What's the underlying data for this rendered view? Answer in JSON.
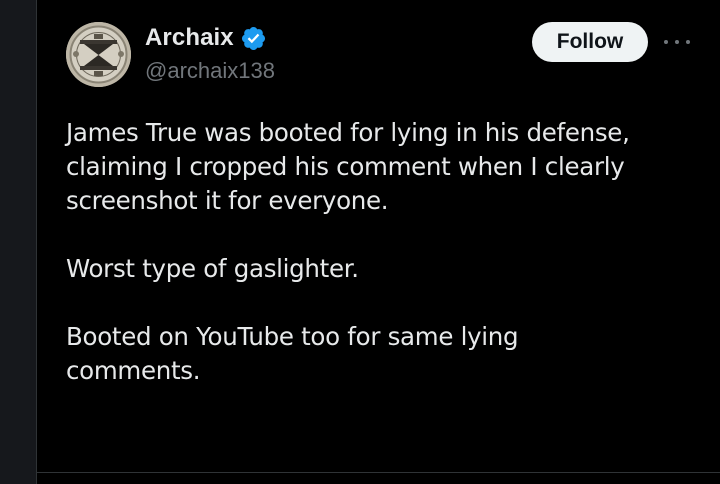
{
  "author": {
    "display_name": "Archaix",
    "handle": "@archaix138",
    "verified": true,
    "verified_color": "#1d9bf0"
  },
  "actions": {
    "follow_label": "Follow",
    "more_icon": "more-horizontal-icon"
  },
  "tweet": {
    "lines": [
      "James True was booted for lying in his defense,",
      "claiming I cropped his comment when I clearly",
      "screenshot it for everyone.",
      "",
      "Worst type of gaslighter.",
      "",
      "Booted on YouTube too for same lying",
      "comments."
    ]
  },
  "colors": {
    "background": "#000000",
    "text_primary": "#e7e9ea",
    "text_secondary": "#71767b",
    "follow_bg": "#eff3f4"
  }
}
